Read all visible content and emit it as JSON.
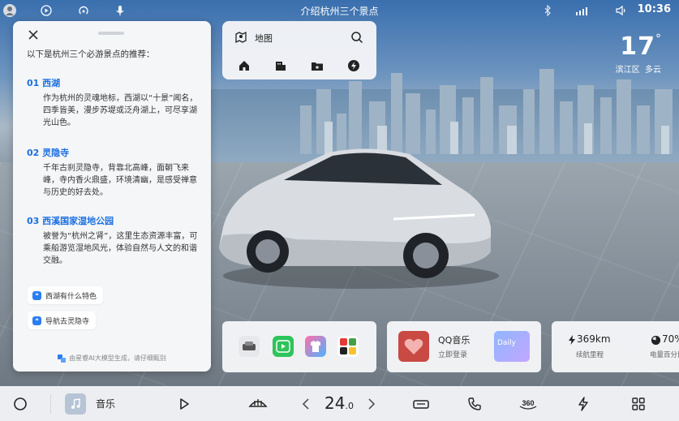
{
  "status_bar": {
    "title": "介绍杭州三个景点",
    "clock": "10:36"
  },
  "weather": {
    "temp": "17",
    "deg": "°",
    "location": "滨江区",
    "condition": "多云"
  },
  "assistant_panel": {
    "intro": "以下是杭州三个必游景点的推荐：",
    "spots": [
      {
        "num": "01",
        "name": "西湖",
        "desc": "作为杭州的灵魂地标，西湖以“十景”闻名，四季皆美，漫步苏堤或泛舟湖上，可尽享湖光山色。"
      },
      {
        "num": "02",
        "name": "灵隐寺",
        "desc": "千年古刹灵隐寺，背靠北高峰，面朝飞来峰，寺内香火鼎盛，环境清幽，是感受禅意与历史的好去处。"
      },
      {
        "num": "03",
        "name": "西溪国家湿地公园",
        "desc": "被誉为“杭州之肾”，这里生态资源丰富，可乘船游览湿地风光，体验自然与人文的和谐交融。"
      }
    ],
    "suggestions": [
      "西湖有什么特色",
      "导航去灵隐寺"
    ],
    "footnote": "由星睿AI大模型生成，请仔细甄别"
  },
  "map_card": {
    "label": "地图"
  },
  "music_card": {
    "title": "QQ音乐",
    "subtitle": "立即登录",
    "cover_text": "Daily"
  },
  "stats_card": {
    "range_value": "369km",
    "range_label": "续航里程",
    "battery_value": "70%",
    "battery_label": "电量百分比"
  },
  "dock": {
    "music_label": "音乐",
    "temp_int": "24",
    "temp_dec": ".0"
  },
  "colors": {
    "accent": "#1a6fe0",
    "panel_bg": "#f5f6f8",
    "dock_bg": "#eceef1"
  }
}
